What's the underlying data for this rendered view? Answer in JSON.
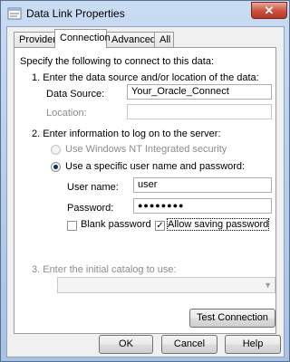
{
  "window": {
    "title": "Data Link Properties",
    "close_glyph": "✕"
  },
  "tabs": [
    "Provider",
    "Connection",
    "Advanced",
    "All"
  ],
  "panel": {
    "intro": "Specify the following to connect to this data:",
    "step1": "1. Enter the data source and/or location of the data:",
    "data_source_label": "Data Source:",
    "data_source_value": "Your_Oracle_Connect",
    "location_label": "Location:",
    "location_value": "",
    "step2": "2. Enter information to log on to the server:",
    "radio_nt": "Use Windows NT Integrated security",
    "radio_specific": "Use a specific user name and password:",
    "username_label": "User name:",
    "username_value": "user",
    "password_label": "Password:",
    "password_value": "●●●●●●●●",
    "blank_password": "Blank password",
    "allow_saving": "Allow saving password",
    "allow_saving_check": "✓",
    "step3": "3. Enter the initial catalog to use:",
    "combo_arrow": "▼",
    "test_connection": "Test Connection"
  },
  "buttons": {
    "ok": "OK",
    "cancel": "Cancel",
    "help": "Help"
  }
}
